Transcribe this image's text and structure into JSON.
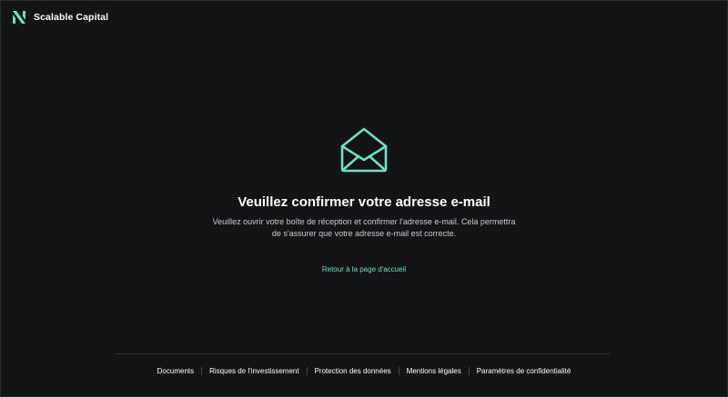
{
  "header": {
    "brand": "Scalable Capital",
    "logo_icon": "scalable-logo-icon"
  },
  "main": {
    "icon": "open-envelope-icon",
    "title": "Veuillez confirmer votre adresse e-mail",
    "description_line1": "Veuillez ouvrir votre boîte de réception et confirmer l'adresse e-mail. Cela permettra",
    "description_line2": "de s'assurer que votre adresse e-mail est correcte.",
    "back_link": "Retour à la page d'accueil"
  },
  "footer": {
    "links": [
      "Documents",
      "Risques de l'investissement",
      "Protection des données",
      "Mentions légales",
      "Paramètres de confidentialité"
    ]
  },
  "colors": {
    "background": "#121416",
    "accent": "#6fe0c6",
    "text": "#ffffff",
    "muted_text": "#c9cdd1"
  }
}
